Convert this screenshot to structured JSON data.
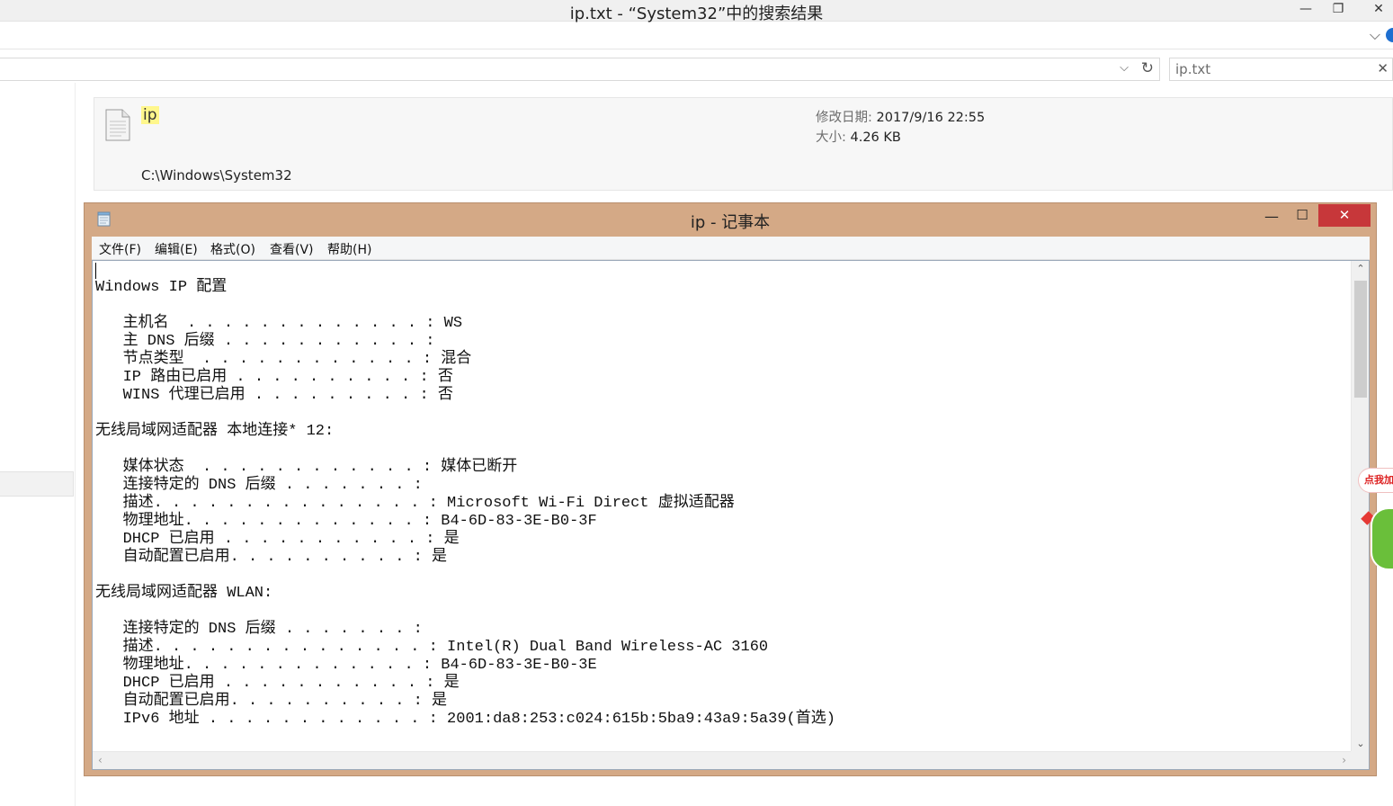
{
  "explorer": {
    "window_title": "ip.txt - “System32”中的搜索结果",
    "min_glyph": "—",
    "max_glyph": "❐",
    "close_glyph": "✕",
    "ribbon_expand_glyph": "⌵",
    "search": {
      "value": "ip.txt",
      "clear_glyph": "✕"
    },
    "address": {
      "dropdown_glyph": "⌵",
      "refresh_glyph": "↻"
    },
    "result": {
      "name": "ip",
      "path": "C:\\Windows\\System32",
      "modified_label": "修改日期:",
      "modified_value": "2017/9/16 22:55",
      "size_label": "大小:",
      "size_value": "4.26 KB"
    }
  },
  "notepad": {
    "title": "ip - 记事本",
    "min_glyph": "—",
    "max_glyph": "☐",
    "close_glyph": "✕",
    "menu": [
      "文件(F)",
      "编辑(E)",
      "格式(O)",
      "查看(V)",
      "帮助(H)"
    ],
    "content": "\nWindows IP 配置\n\n   主机名  . . . . . . . . . . . . . : WS\n   主 DNS 后缀 . . . . . . . . . . . :\n   节点类型  . . . . . . . . . . . . : 混合\n   IP 路由已启用 . . . . . . . . . . : 否\n   WINS 代理已启用 . . . . . . . . . : 否\n\n无线局域网适配器 本地连接* 12:\n\n   媒体状态  . . . . . . . . . . . . : 媒体已断开\n   连接特定的 DNS 后缀 . . . . . . . :\n   描述. . . . . . . . . . . . . . . : Microsoft Wi-Fi Direct 虚拟适配器\n   物理地址. . . . . . . . . . . . . : B4-6D-83-3E-B0-3F\n   DHCP 已启用 . . . . . . . . . . . : 是\n   自动配置已启用. . . . . . . . . . : 是\n\n无线局域网适配器 WLAN:\n\n   连接特定的 DNS 后缀 . . . . . . . :\n   描述. . . . . . . . . . . . . . . : Intel(R) Dual Band Wireless-AC 3160\n   物理地址. . . . . . . . . . . . . : B4-6D-83-3E-B0-3E\n   DHCP 已启用 . . . . . . . . . . . : 是\n   自动配置已启用. . . . . . . . . . : 是\n   IPv6 地址 . . . . . . . . . . . . : 2001:da8:253:c024:615b:5ba9:43a9:5a39(首选)",
    "scroll": {
      "up_glyph": "⌃",
      "down_glyph": "⌄",
      "left_glyph": "‹",
      "right_glyph": "›"
    }
  },
  "widget": {
    "label": "点我加"
  },
  "colors": {
    "notepad_frame": "#d4a986",
    "close_button": "#c7373a",
    "search_highlight": "#fff78c"
  }
}
